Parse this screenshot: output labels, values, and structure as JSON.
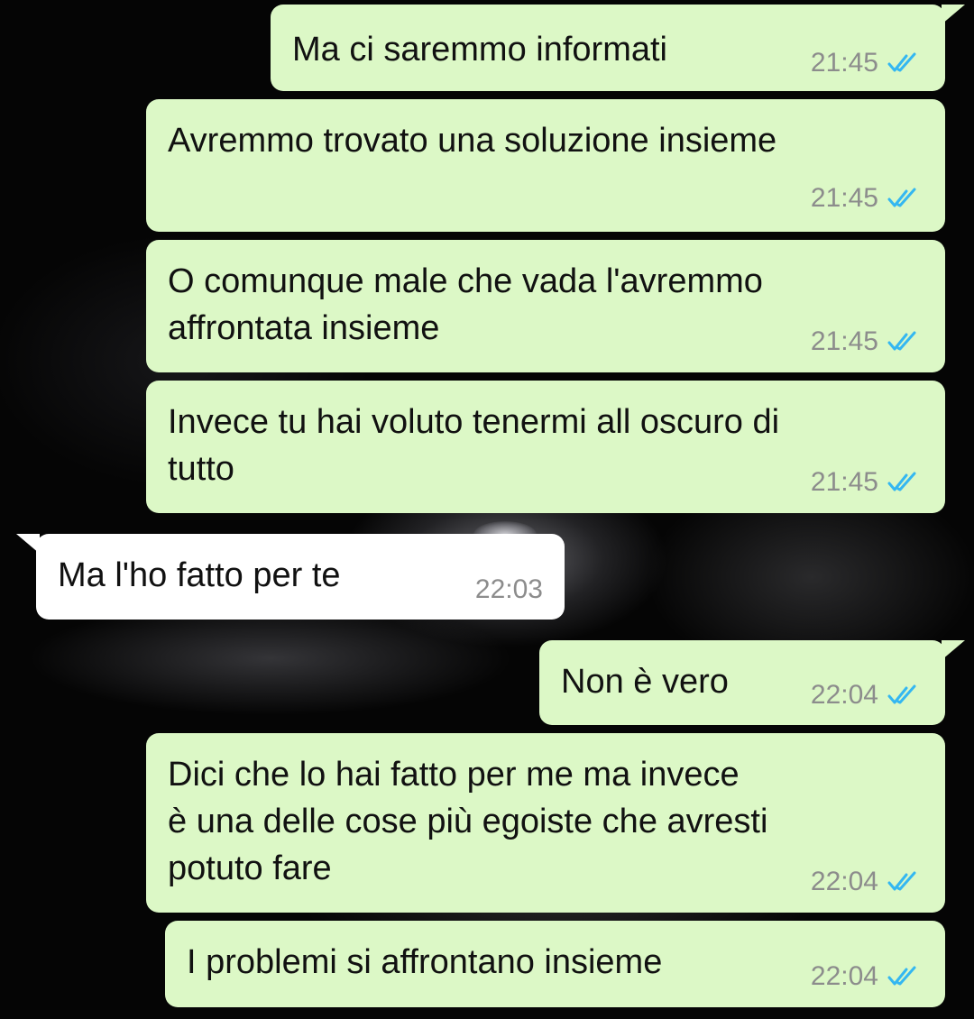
{
  "conversation": {
    "messages": [
      {
        "direction": "outgoing",
        "lines": [
          "Ma ci saremmo informati"
        ],
        "time": "21:45",
        "status": "read-double-check-icon"
      },
      {
        "direction": "outgoing",
        "lines": [
          "Avremmo trovato una soluzione insieme"
        ],
        "time": "21:45",
        "status": "read-double-check-icon"
      },
      {
        "direction": "outgoing",
        "lines": [
          "O comunque male che vada l'avremmo",
          "affrontata insieme"
        ],
        "time": "21:45",
        "status": "read-double-check-icon"
      },
      {
        "direction": "outgoing",
        "lines": [
          "Invece tu hai voluto tenermi all oscuro di",
          "tutto"
        ],
        "time": "21:45",
        "status": "read-double-check-icon"
      },
      {
        "direction": "incoming",
        "lines": [
          "Ma l'ho fatto per te"
        ],
        "time": "22:03"
      },
      {
        "direction": "outgoing",
        "lines": [
          "Non è vero"
        ],
        "time": "22:04",
        "status": "read-double-check-icon"
      },
      {
        "direction": "outgoing",
        "lines": [
          "Dici che lo hai fatto per me ma invece",
          "è una delle cose più egoiste che avresti",
          "potuto fare"
        ],
        "time": "22:04",
        "status": "read-double-check-icon"
      },
      {
        "direction": "outgoing",
        "lines": [
          "I problemi si affrontano insieme"
        ],
        "time": "22:04",
        "status": "read-double-check-icon"
      }
    ]
  },
  "colors": {
    "outgoing_bubble": "#dcf8c6",
    "incoming_bubble": "#ffffff",
    "read_tick": "#34b7f1",
    "timestamp": "#8c8c8c",
    "wallpaper": "#050505"
  }
}
